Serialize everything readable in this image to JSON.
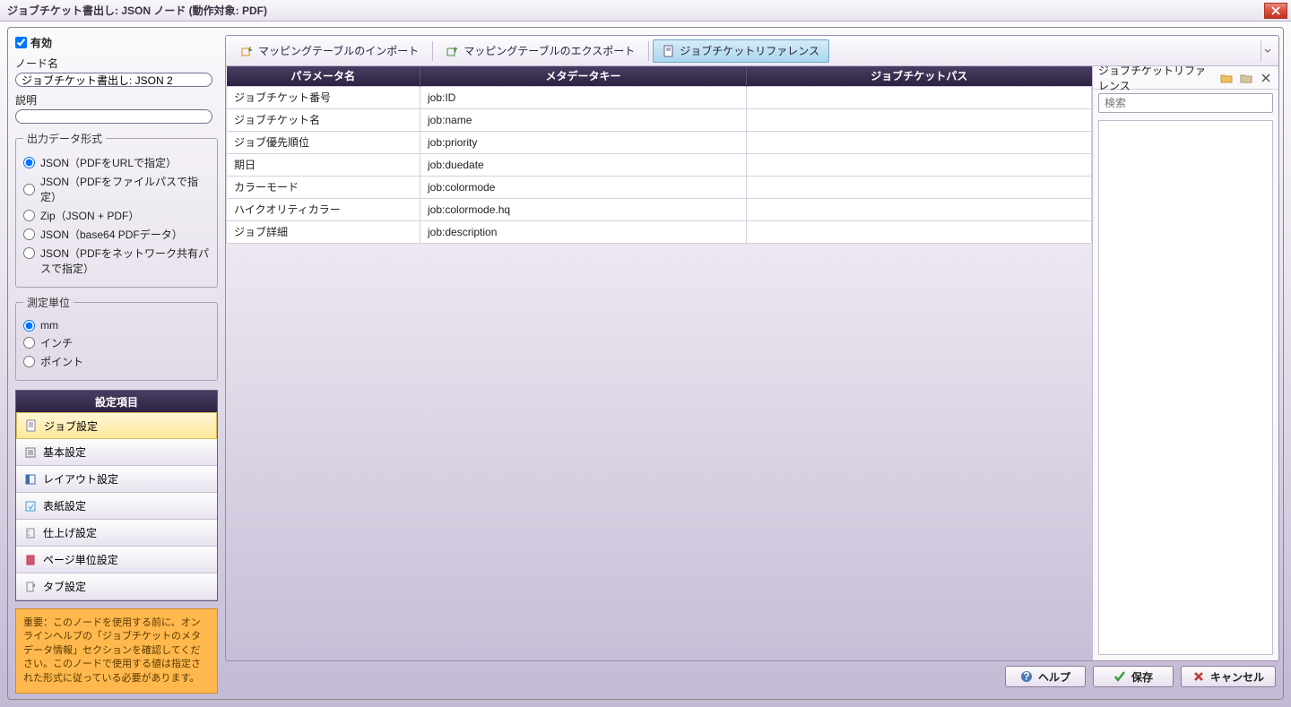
{
  "title": "ジョブチケット書出し: JSON ノード (動作対象: PDF)",
  "sidebar": {
    "enabled_label": "有効",
    "node_name_label": "ノード名",
    "node_name_value": "ジョブチケット書出し: JSON 2",
    "description_label": "説明",
    "description_value": "",
    "output_format_legend": "出力データ形式",
    "output_formats": [
      "JSON（PDFをURLで指定）",
      "JSON（PDFをファイルパスで指定）",
      "Zip（JSON + PDF）",
      "JSON（base64 PDFデータ）",
      "JSON（PDFをネットワーク共有パスで指定）"
    ],
    "unit_legend": "測定単位",
    "units": [
      "mm",
      "インチ",
      "ポイント"
    ],
    "settings_header": "設定項目",
    "settings_items": [
      "ジョブ設定",
      "基本設定",
      "レイアウト設定",
      "表紙設定",
      "仕上げ設定",
      "ページ単位設定",
      "タブ設定"
    ],
    "warning": "重要：このノードを使用する前に、オンラインヘルプの「ジョブチケットのメタデータ情報」セクションを確認してください。このノードで使用する値は指定された形式に従っている必要があります。"
  },
  "toolbar": {
    "import": "マッピングテーブルのインポート",
    "export": "マッピングテーブルのエクスポート",
    "reference": "ジョブチケットリファレンス"
  },
  "table": {
    "headers": [
      "パラメータ名",
      "メタデータキー",
      "ジョブチケットパス"
    ],
    "rows": [
      {
        "param": "ジョブチケット番号",
        "meta": "job:ID",
        "path": ""
      },
      {
        "param": "ジョブチケット名",
        "meta": "job:name",
        "path": ""
      },
      {
        "param": "ジョブ優先順位",
        "meta": "job:priority",
        "path": ""
      },
      {
        "param": "期日",
        "meta": "job:duedate",
        "path": ""
      },
      {
        "param": "カラーモード",
        "meta": "job:colormode",
        "path": ""
      },
      {
        "param": "ハイクオリティカラー",
        "meta": "job:colormode.hq",
        "path": ""
      },
      {
        "param": "ジョブ詳細",
        "meta": "job:description",
        "path": ""
      }
    ]
  },
  "refpanel": {
    "title": "ジョブチケットリファレンス",
    "search_placeholder": "検索"
  },
  "footer": {
    "help": "ヘルプ",
    "save": "保存",
    "cancel": "キャンセル"
  }
}
